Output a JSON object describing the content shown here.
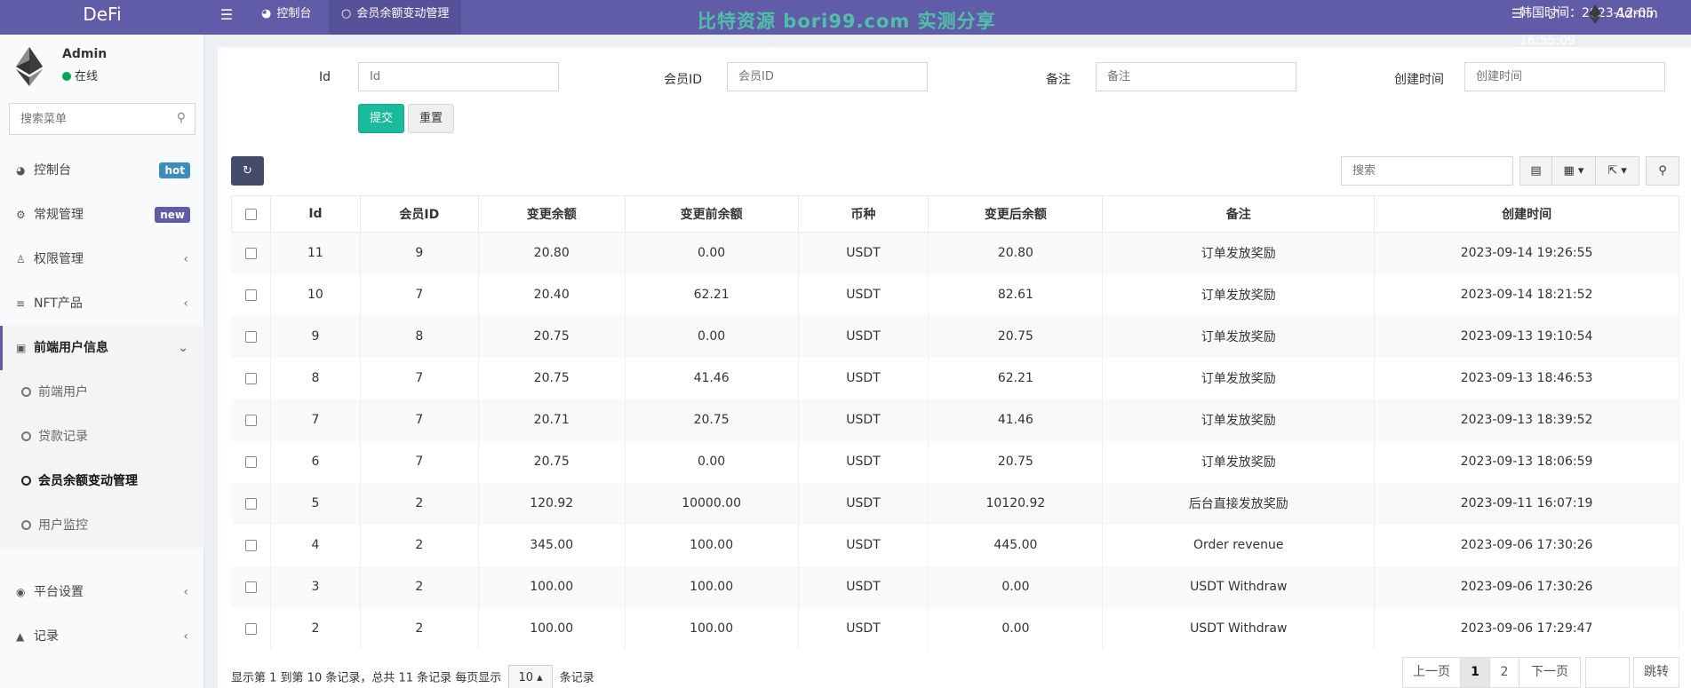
{
  "header": {
    "logo": "DeFi",
    "tabs": [
      {
        "label": "控制台"
      },
      {
        "label": "会员余额变动管理"
      }
    ],
    "watermark": "比特资源 bori99.com 实测分享",
    "time_label": "韩国时间：2023-12-05 16:55:09",
    "admin": "Admin"
  },
  "sidebar": {
    "user": {
      "name": "Admin",
      "status": "在线"
    },
    "search_placeholder": "搜索菜单",
    "items": [
      {
        "label": "控制台",
        "badge": "hot"
      },
      {
        "label": "常规管理",
        "badge": "new"
      },
      {
        "label": "权限管理"
      },
      {
        "label": "NFT产品"
      },
      {
        "label": "前端用户信息"
      },
      {
        "label": "平台设置"
      },
      {
        "label": "记录"
      }
    ],
    "sub_items": [
      {
        "label": "前端用户"
      },
      {
        "label": "贷款记录"
      },
      {
        "label": "会员余额变动管理"
      },
      {
        "label": "用户监控"
      }
    ],
    "colors": {
      "hot": "#3c8dbc",
      "new": "#605ca8"
    }
  },
  "filters": {
    "fields": [
      {
        "label": "Id",
        "placeholder": "Id"
      },
      {
        "label": "会员ID",
        "placeholder": "会员ID"
      },
      {
        "label": "备注",
        "placeholder": "备注"
      },
      {
        "label": "创建时间",
        "placeholder": "创建时间"
      }
    ],
    "submit": "提交",
    "reset": "重置"
  },
  "toolbar": {
    "search_placeholder": "搜索"
  },
  "table": {
    "columns": [
      "Id",
      "会员ID",
      "变更余额",
      "变更前余额",
      "币种",
      "变更后余额",
      "备注",
      "创建时间"
    ],
    "rows": [
      [
        "11",
        "9",
        "20.80",
        "0.00",
        "USDT",
        "20.80",
        "订单发放奖励",
        "2023-09-14 19:26:55"
      ],
      [
        "10",
        "7",
        "20.40",
        "62.21",
        "USDT",
        "82.61",
        "订单发放奖励",
        "2023-09-14 18:21:52"
      ],
      [
        "9",
        "8",
        "20.75",
        "0.00",
        "USDT",
        "20.75",
        "订单发放奖励",
        "2023-09-13 19:10:54"
      ],
      [
        "8",
        "7",
        "20.75",
        "41.46",
        "USDT",
        "62.21",
        "订单发放奖励",
        "2023-09-13 18:46:53"
      ],
      [
        "7",
        "7",
        "20.71",
        "20.75",
        "USDT",
        "41.46",
        "订单发放奖励",
        "2023-09-13 18:39:52"
      ],
      [
        "6",
        "7",
        "20.75",
        "0.00",
        "USDT",
        "20.75",
        "订单发放奖励",
        "2023-09-13 18:06:59"
      ],
      [
        "5",
        "2",
        "120.92",
        "10000.00",
        "USDT",
        "10120.92",
        "后台直接发放奖励",
        "2023-09-11 16:07:19"
      ],
      [
        "4",
        "2",
        "345.00",
        "100.00",
        "USDT",
        "445.00",
        "Order revenue",
        "2023-09-06 17:30:26"
      ],
      [
        "3",
        "2",
        "100.00",
        "100.00",
        "USDT",
        "0.00",
        "USDT Withdraw",
        "2023-09-06 17:30:26"
      ],
      [
        "2",
        "2",
        "100.00",
        "100.00",
        "USDT",
        "0.00",
        "USDT Withdraw",
        "2023-09-06 17:29:47"
      ]
    ]
  },
  "pagination": {
    "info_prefix": "显示第 1 到第 10 条记录，总共 11 条记录 每页显示",
    "page_size": "10",
    "info_suffix": "条记录",
    "prev": "上一页",
    "pages": [
      "1",
      "2"
    ],
    "next": "下一页",
    "jump": "跳转"
  }
}
